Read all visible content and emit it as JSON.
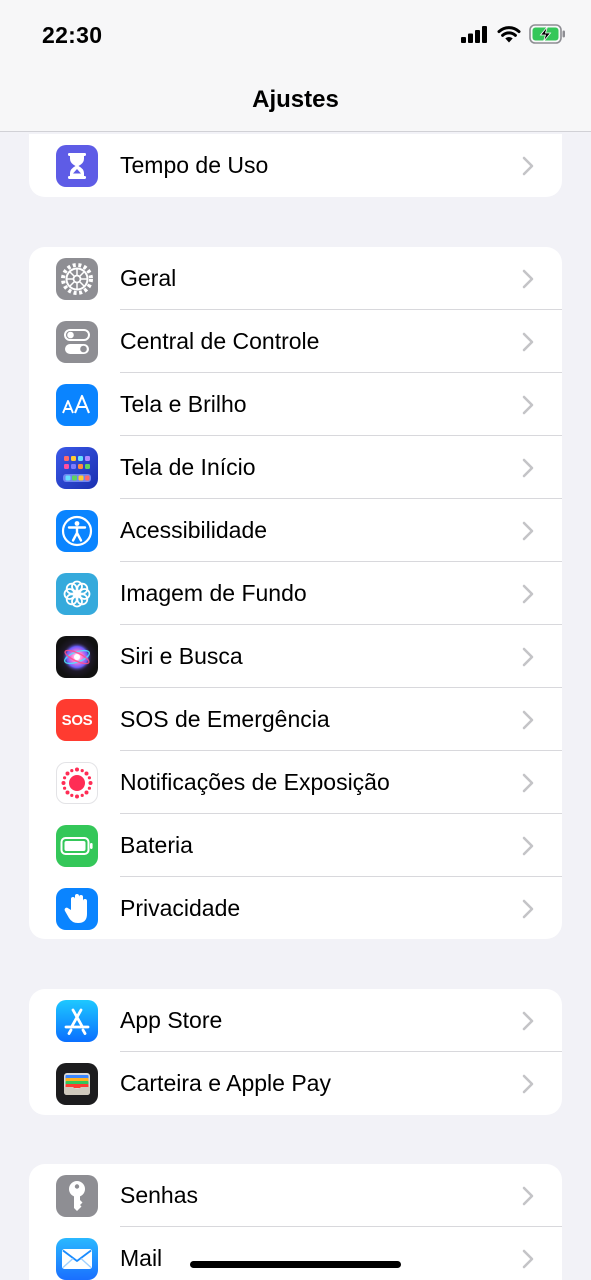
{
  "status_bar": {
    "time": "22:30",
    "icons": [
      "cellular-signal-icon",
      "wifi-icon",
      "battery-charging-icon"
    ]
  },
  "nav": {
    "title": "Ajustes"
  },
  "groups": [
    {
      "items": [
        {
          "label": "Tempo de Uso",
          "icon": "hourglass-icon",
          "color": "#5e5ce6"
        }
      ]
    },
    {
      "items": [
        {
          "label": "Geral",
          "icon": "gear-icon",
          "color": "#8e8e93"
        },
        {
          "label": "Central de Controle",
          "icon": "toggles-icon",
          "color": "#8e8e93"
        },
        {
          "label": "Tela e Brilho",
          "icon": "text-size-icon",
          "color": "#0a84ff"
        },
        {
          "label": "Tela de Início",
          "icon": "home-screen-grid-icon",
          "color": "#2c4fd8"
        },
        {
          "label": "Acessibilidade",
          "icon": "accessibility-icon",
          "color": "#0a84ff"
        },
        {
          "label": "Imagem de Fundo",
          "icon": "flower-icon",
          "color": "#35aadc"
        },
        {
          "label": "Siri e Busca",
          "icon": "siri-icon",
          "color": "#1c1c1e"
        },
        {
          "label": "SOS de Emergência",
          "icon": "sos-icon",
          "color": "#ff3b30",
          "icon_text": "SOS"
        },
        {
          "label": "Notificações de Exposição",
          "icon": "exposure-notification-icon",
          "color": "#ffffff"
        },
        {
          "label": "Bateria",
          "icon": "battery-icon",
          "color": "#34c759"
        },
        {
          "label": "Privacidade",
          "icon": "hand-icon",
          "color": "#0a84ff"
        }
      ]
    },
    {
      "items": [
        {
          "label": "App Store",
          "icon": "app-store-icon",
          "color": "#0a84ff"
        },
        {
          "label": "Carteira e Apple Pay",
          "icon": "wallet-icon",
          "color": "#1c1c1e"
        }
      ]
    },
    {
      "items": [
        {
          "label": "Senhas",
          "icon": "key-icon",
          "color": "#8e8e93"
        },
        {
          "label": "Mail",
          "icon": "mail-icon",
          "color": "#1e90ff"
        }
      ]
    }
  ]
}
